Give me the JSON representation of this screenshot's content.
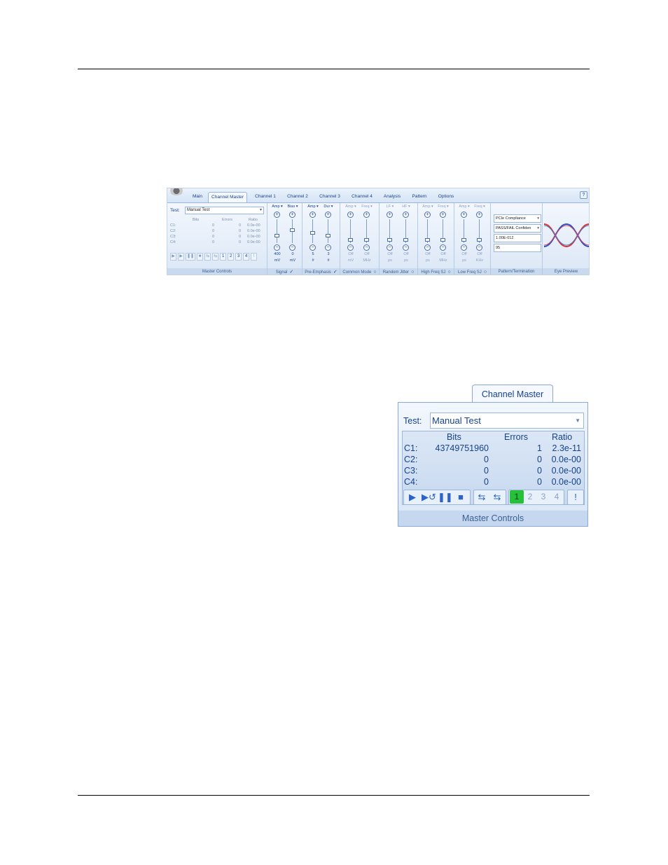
{
  "ribbon": {
    "tabs": [
      "Main",
      "Channel Master",
      "Channel 1",
      "Channel 2",
      "Channel 3",
      "Channel 4",
      "Analysis",
      "Pattern",
      "Options"
    ],
    "master_controls": {
      "test_label": "Test:",
      "test_value": "Manual Test",
      "headers": [
        "Bits",
        "Errors",
        "Ratio"
      ],
      "rows": [
        {
          "ch": "C1:",
          "bits": "0",
          "ratio": "0.0e-00"
        },
        {
          "ch": "C2:",
          "bits": "0",
          "ratio": "0.0e-00"
        },
        {
          "ch": "C3:",
          "bits": "0",
          "ratio": "0.0e-00"
        },
        {
          "ch": "C4:",
          "bits": "0",
          "ratio": "0.0e-00"
        }
      ],
      "channel_buttons": [
        "1",
        "2",
        "3",
        "4"
      ],
      "caption": "Master Controls"
    },
    "groups": {
      "signal": {
        "caption": "Signal",
        "mark": "✓",
        "cols": [
          {
            "head": "Amp ▾",
            "value": "400",
            "unit": "mV"
          },
          {
            "head": "Bias ▾",
            "value": "0",
            "unit": "mV"
          }
        ]
      },
      "pre_emphasis": {
        "caption": "Pre-Emphasis",
        "mark": "✓",
        "cols": [
          {
            "head": "Amp ▾",
            "value": "5",
            "unit": "#"
          },
          {
            "head": "Dur ▾",
            "value": "3",
            "unit": "#"
          }
        ]
      },
      "common_mode": {
        "caption": "Common Mode",
        "mark": "○",
        "cols": [
          {
            "head": "Amp ▾",
            "value": "Off",
            "unit": "mV"
          },
          {
            "head": "Freq ▾",
            "value": "Off",
            "unit": "MHz"
          }
        ]
      },
      "random_jitter": {
        "caption": "Random Jitter",
        "mark": "○",
        "cols": [
          {
            "head": "LF ▾",
            "value": "Off",
            "unit": "ps"
          },
          {
            "head": "HF ▾",
            "value": "Off",
            "unit": "ps"
          }
        ]
      },
      "high_freq_sj": {
        "caption": "High Freq SJ",
        "mark": "○",
        "cols": [
          {
            "head": "Amp ▾",
            "value": "Off",
            "unit": "ps"
          },
          {
            "head": "Freq ▾",
            "value": "Off",
            "unit": "MHz"
          }
        ]
      },
      "low_freq_sj": {
        "caption": "Low Freq SJ",
        "mark": "○",
        "cols": [
          {
            "head": "Amp ▾",
            "value": "Off",
            "unit": "ps"
          },
          {
            "head": "Freq ▾",
            "value": "Off",
            "unit": "KHz"
          }
        ]
      },
      "pattern_termination": {
        "caption": "Pattern/Termination",
        "pattern": "PCIe Compliance",
        "mode": "PASS/FAIL Confiden",
        "ber": "1.00E-012",
        "confidence": "95"
      },
      "eye_preview": {
        "caption": "Eye Preview"
      }
    }
  },
  "zoom": {
    "tab_label": "Channel Master",
    "test_label": "Test:",
    "test_value": "Manual Test",
    "headers": {
      "bits": "Bits",
      "errors": "Errors",
      "ratio": "Ratio"
    },
    "rows": [
      {
        "ch": "C1:",
        "bits": "43749751960",
        "errors": "1",
        "ratio": "2.3e-11"
      },
      {
        "ch": "C2:",
        "bits": "0",
        "errors": "0",
        "ratio": "0.0e-00"
      },
      {
        "ch": "C3:",
        "bits": "0",
        "errors": "0",
        "ratio": "0.0e-00"
      },
      {
        "ch": "C4:",
        "bits": "0",
        "errors": "0",
        "ratio": "0.0e-00"
      }
    ],
    "channel_buttons": [
      "1",
      "2",
      "3",
      "4"
    ],
    "active_channel": "1",
    "caption": "Master Controls"
  }
}
